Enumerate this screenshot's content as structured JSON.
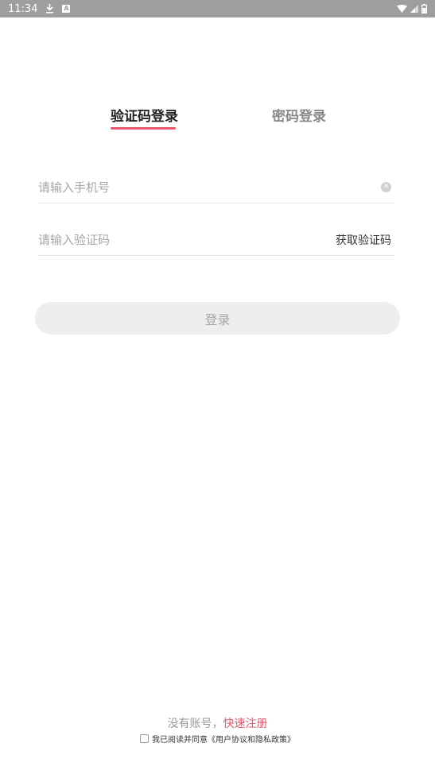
{
  "status_bar": {
    "time": "11:34",
    "icons": [
      "download-icon",
      "app-a-icon",
      "wifi-icon",
      "signal-icon",
      "battery-icon"
    ]
  },
  "tabs": {
    "sms_login": "验证码登录",
    "password_login": "密码登录",
    "active": "sms_login"
  },
  "form": {
    "phone_placeholder": "请输入手机号",
    "code_placeholder": "请输入验证码",
    "get_code_label": "获取验证码"
  },
  "login_button": "登录",
  "footer": {
    "no_account": "没有账号，",
    "register": "快速注册",
    "agree_text": "我已阅读并同意《用户协议和隐私政策》"
  },
  "colors": {
    "accent": "#e8566e",
    "status_bar": "#9e9e9e",
    "button_bg": "#eeeeee"
  }
}
